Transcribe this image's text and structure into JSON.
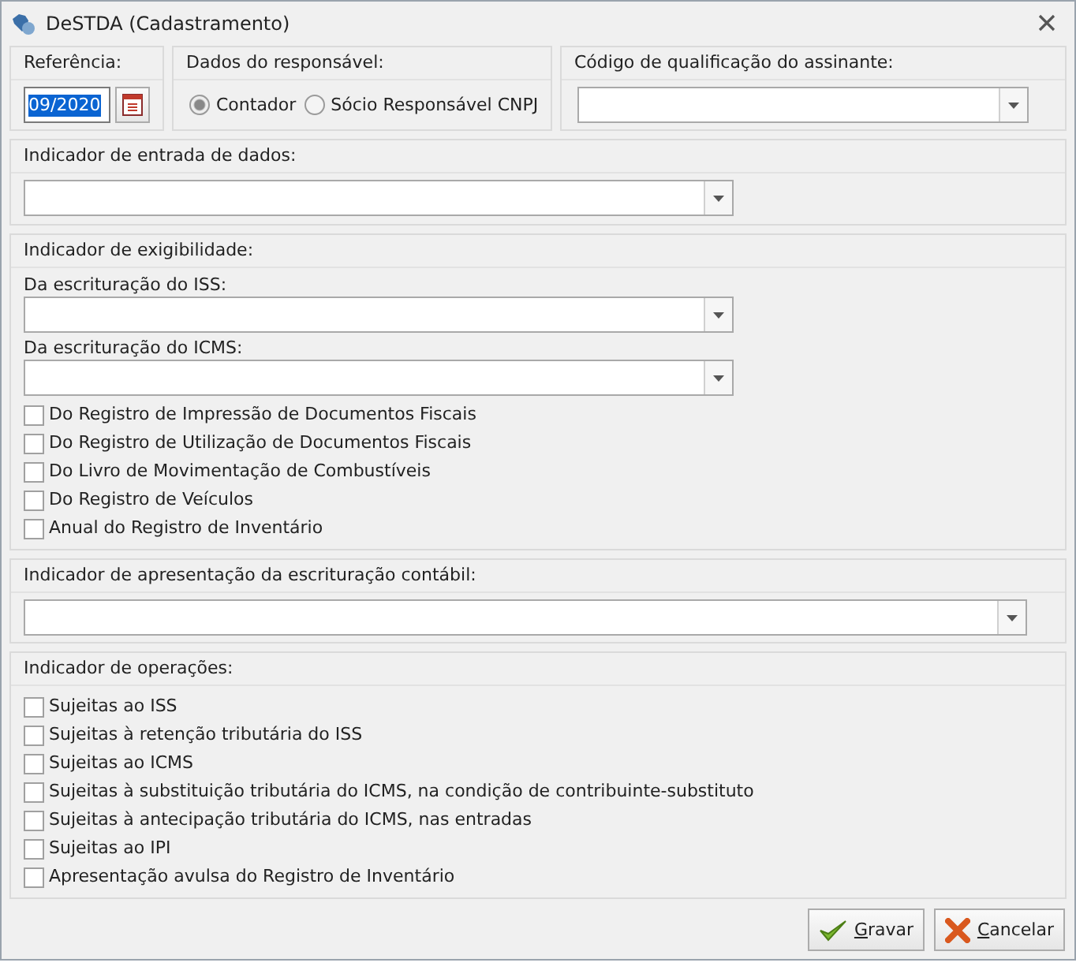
{
  "window": {
    "title": "DeSTDA (Cadastramento)"
  },
  "referencia": {
    "label": "Referência:",
    "value": "09/2020",
    "highlighted": true
  },
  "responsavel": {
    "label": "Dados do responsável:",
    "options": [
      {
        "label": "Contador",
        "selected": true
      },
      {
        "label": "Sócio Responsável CNPJ",
        "selected": false
      }
    ]
  },
  "qualificacao": {
    "label": "Código de qualificação do assinante:"
  },
  "entrada": {
    "label": "Indicador de entrada de dados:"
  },
  "exigibilidade": {
    "label": "Indicador de exigibilidade:",
    "dropdowns": [
      {
        "label": "Da escrituração do ISS:"
      },
      {
        "label": "Da escrituração do ICMS:"
      }
    ],
    "checkboxes": [
      {
        "label": "Do Registro de Impressão de Documentos Fiscais",
        "checked": false
      },
      {
        "label": "Do Registro de Utilização de Documentos Fiscais",
        "checked": false
      },
      {
        "label": "Do Livro de Movimentação de Combustíveis",
        "checked": false
      },
      {
        "label": "Do Registro de Veículos",
        "checked": false
      },
      {
        "label": "Anual do Registro de Inventário",
        "checked": false
      }
    ]
  },
  "apresentacao": {
    "label": "Indicador de apresentação da escrituração contábil:"
  },
  "operacoes": {
    "label": "Indicador de operações:",
    "checkboxes": [
      {
        "label": "Sujeitas ao ISS",
        "checked": false
      },
      {
        "label": "Sujeitas à retenção tributária do ISS",
        "checked": false
      },
      {
        "label": "Sujeitas ao ICMS",
        "checked": false
      },
      {
        "label": "Sujeitas à substituição tributária do ICMS, na condição de contribuinte-substituto",
        "checked": false
      },
      {
        "label": "Sujeitas à antecipação tributária do ICMS, nas entradas",
        "checked": false
      },
      {
        "label": "Sujeitas ao IPI",
        "checked": false
      },
      {
        "label": "Apresentação avulsa do Registro de Inventário",
        "checked": false
      }
    ]
  },
  "buttons": [
    {
      "kind": "save",
      "label": "Gravar"
    },
    {
      "kind": "cancel",
      "label": "Cancelar"
    }
  ]
}
